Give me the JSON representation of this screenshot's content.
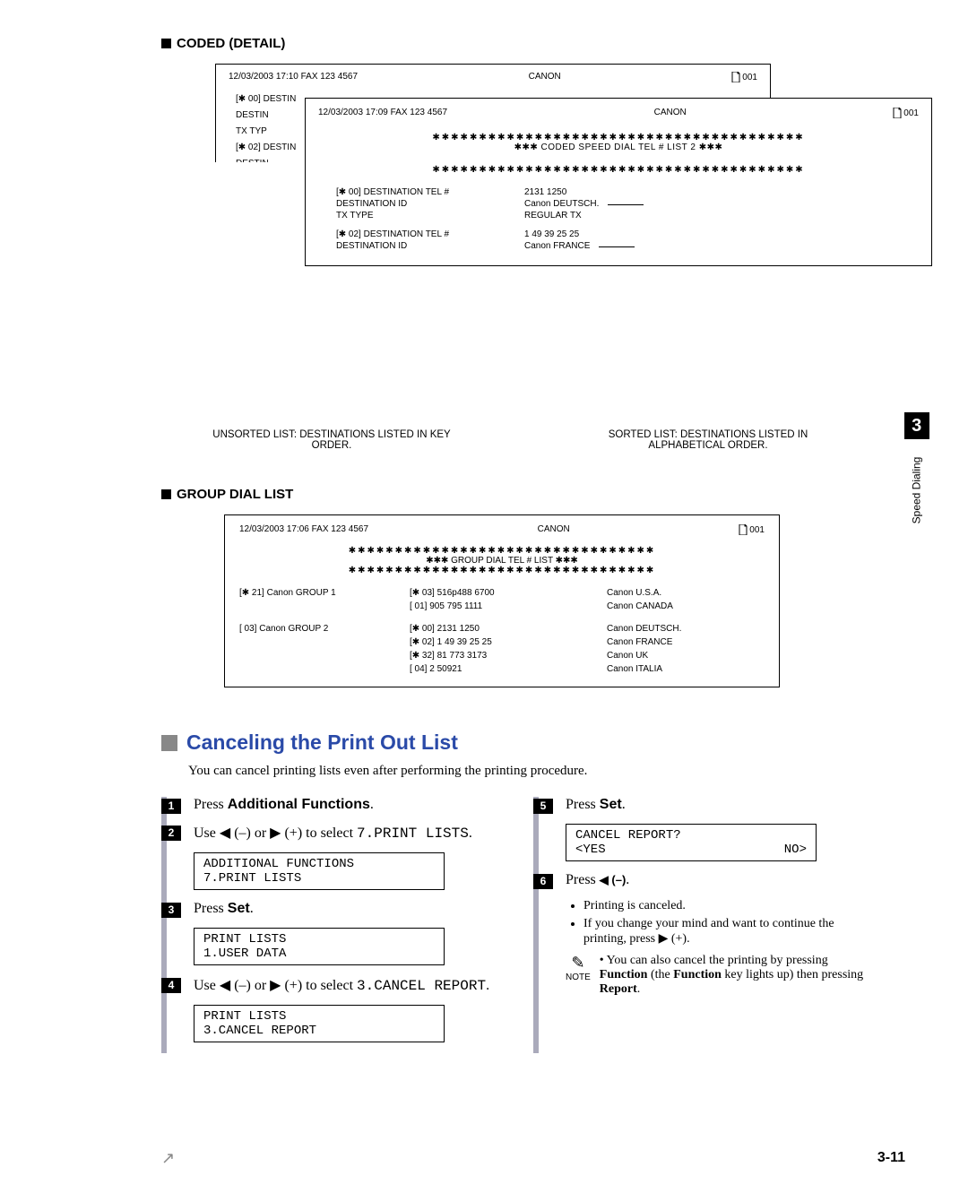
{
  "coded_detail": {
    "heading": "CODED (DETAIL)",
    "back": {
      "datetime": "12/03/2003  17:10  FAX 123 4567",
      "center": "CANON",
      "page": "001",
      "body_lines": [
        "[✱  00] DESTIN",
        "          DESTIN",
        "          TX TYP",
        "[✱  02] DESTIN",
        "          DESTIN"
      ]
    },
    "front": {
      "datetime": "12/03/2003  17:09  FAX 123 4567",
      "center": "CANON",
      "page": "001",
      "stars_top": "✱✱✱✱✱✱✱✱✱✱✱✱✱✱✱✱✱✱✱✱✱✱✱✱✱✱✱✱✱✱✱✱✱✱✱✱✱✱✱✱",
      "title": "✱✱✱    CODED SPEED DIAL TEL # LIST 2    ✱✱✱",
      "stars_bottom": "✱✱✱✱✱✱✱✱✱✱✱✱✱✱✱✱✱✱✱✱✱✱✱✱✱✱✱✱✱✱✱✱✱✱✱✱✱✱✱✱",
      "rows": [
        {
          "label": "[✱  00] DESTINATION TEL #",
          "value": "2131 1250",
          "line": false
        },
        {
          "label": "          DESTINATION ID",
          "value": "Canon DEUTSCH.",
          "line": true
        },
        {
          "label": "          TX TYPE",
          "value": "REGULAR TX",
          "line": false
        },
        {
          "label": "[✱  02] DESTINATION TEL #",
          "value": "1 49 39 25 25",
          "line": false
        },
        {
          "label": "          DESTINATION ID",
          "value": "Canon FRANCE",
          "line": true
        }
      ]
    },
    "caption_left": "UNSORTED LIST: DESTINATIONS LISTED IN KEY ORDER.",
    "caption_right": "SORTED LIST: DESTINATIONS LISTED IN ALPHABETICAL ORDER."
  },
  "group_dial": {
    "heading": "GROUP DIAL LIST",
    "header": {
      "datetime": "12/03/2003  17:06  FAX 123 4567",
      "center": "CANON",
      "page": "001"
    },
    "stars_top": "✱✱✱✱✱✱✱✱✱✱✱✱✱✱✱✱✱✱✱✱✱✱✱✱✱✱✱✱✱✱✱✱✱",
    "title": "✱✱✱    GROUP DIAL TEL # LIST    ✱✱✱",
    "stars_bottom": "✱✱✱✱✱✱✱✱✱✱✱✱✱✱✱✱✱✱✱✱✱✱✱✱✱✱✱✱✱✱✱✱✱",
    "rows": [
      {
        "c1": "[✱  21] Canon GROUP 1",
        "c2": "[✱  03] 516p488 6700",
        "c3": "Canon U.S.A."
      },
      {
        "c1": "",
        "c2": "[     01] 905 795 1111",
        "c3": "Canon CANADA"
      },
      {
        "c1": "",
        "c2": "",
        "c3": ""
      },
      {
        "c1": "[     03] Canon GROUP 2",
        "c2": "[✱  00] 2131 1250",
        "c3": "Canon DEUTSCH."
      },
      {
        "c1": "",
        "c2": "[✱  02] 1 49 39 25 25",
        "c3": "Canon FRANCE"
      },
      {
        "c1": "",
        "c2": "[✱  32] 81 773 3173",
        "c3": "Canon UK"
      },
      {
        "c1": "",
        "c2": "[     04] 2 50921",
        "c3": "Canon ITALIA"
      }
    ]
  },
  "cancel": {
    "heading": "Canceling the Print Out List",
    "intro": "You can cancel printing lists even after performing the printing procedure.",
    "steps_left": [
      {
        "n": "1",
        "html_prefix": "Press ",
        "bold": "Additional Functions",
        "suffix": "."
      },
      {
        "n": "2",
        "text_use": "Use ◀ (–) or ▶ (+) to select",
        "mono": "7.PRINT LISTS",
        "suffix": ".",
        "lcd1": "ADDITIONAL FUNCTIONS",
        "lcd2": " 7.PRINT LISTS"
      },
      {
        "n": "3",
        "html_prefix": "Press ",
        "bold": "Set",
        "suffix": ".",
        "lcd1": "PRINT LISTS",
        "lcd2": " 1.USER DATA"
      },
      {
        "n": "4",
        "text_use": "Use ◀ (–) or ▶ (+) to select",
        "mono": "3.CANCEL REPORT",
        "suffix": ".",
        "lcd1": "PRINT LISTS",
        "lcd2": " 3.CANCEL REPORT"
      }
    ],
    "steps_right": [
      {
        "n": "5",
        "html_prefix": "Press ",
        "bold": "Set",
        "suffix": ".",
        "lcd1": "CANCEL REPORT?",
        "lcd2_left": " <YES",
        "lcd2_right": "NO>"
      },
      {
        "n": "6",
        "html_prefix": "Press ",
        "bold": "◀ (–)",
        "suffix": ".",
        "bullets": [
          "Printing is canceled.",
          "If you change your mind and want to continue the printing, press ▶ (+)."
        ],
        "note_label": "NOTE",
        "note_text_pre": "• You can also cancel the printing by pressing ",
        "note_bold1": "Function",
        "note_mid": " (the ",
        "note_bold2": "Function",
        "note_post": " key lights up) then pressing ",
        "note_bold3": "Report",
        "note_end": "."
      }
    ]
  },
  "side": {
    "chapter": "3",
    "label": "Speed Dialing"
  },
  "page_num": "3-11"
}
